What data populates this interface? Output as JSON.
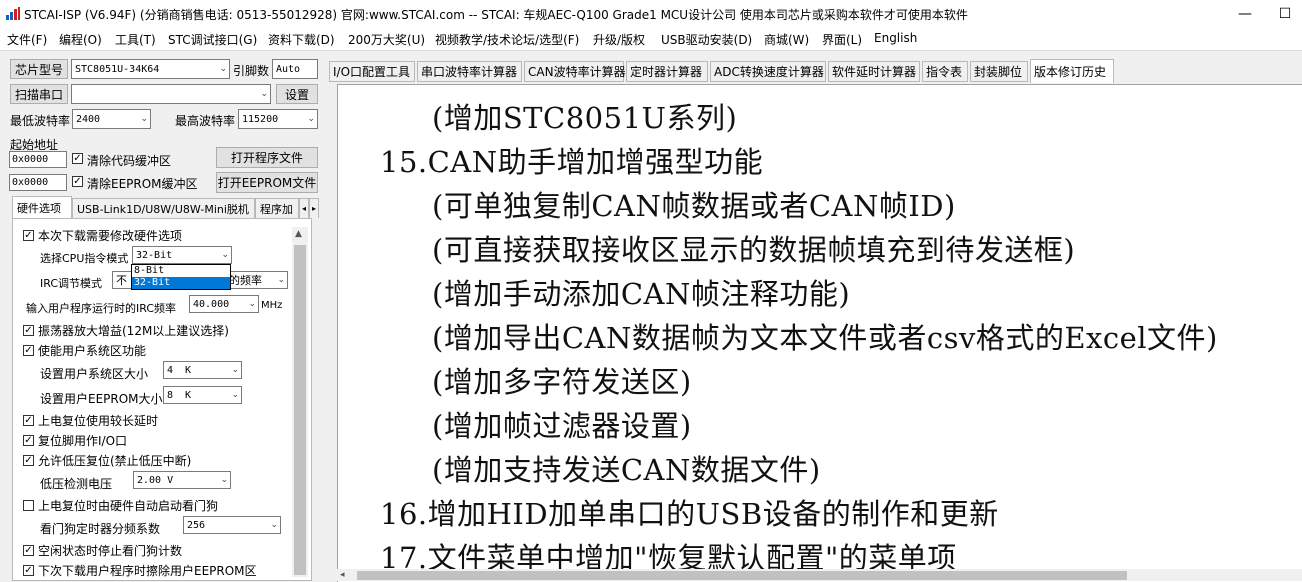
{
  "title": "STCAI-ISP (V6.94F) (分销商销售电话: 0513-55012928) 官网:www.STCAI.com  -- STCAI: 车规AEC-Q100 Grade1 MCU设计公司 使用本司芯片或采购本软件才可使用本软件",
  "window": {
    "minimize": "—",
    "maximize": "☐"
  },
  "menu": [
    "文件(F)",
    "编程(O)",
    "工具(T)",
    "STC调试接口(G)",
    "资料下载(D)",
    "200万大奖(U)",
    "视频教学/技术论坛/选型(F)",
    "升级/版权",
    "USB驱动安装(D)",
    "商城(W)",
    "界面(L)",
    "English"
  ],
  "left": {
    "chip_label": "芯片型号",
    "chip_value": "STC8051U-34K64",
    "pin_label": "引脚数",
    "pin_value": "Auto",
    "scan_label": "扫描串口",
    "port_value": "",
    "settings_label": "设置",
    "min_baud_label": "最低波特率",
    "min_baud_value": "2400",
    "max_baud_label": "最高波特率",
    "max_baud_value": "115200",
    "start_addr_label": "起始地址",
    "addr1": "0x0000",
    "clear_code": "清除代码缓冲区",
    "open_prog": "打开程序文件",
    "addr2": "0x0000",
    "clear_eeprom": "清除EEPROM缓冲区",
    "open_eeprom": "打开EEPROM文件"
  },
  "left_tabs": [
    "硬件选项",
    "USB-Link1D/U8W/U8W-Mini脱机",
    "程序加"
  ],
  "hw": {
    "need_modify": "本次下载需要修改硬件选项",
    "cpu_mode_label": "选择CPU指令模式",
    "cpu_mode_value": "32-Bit",
    "cpu_mode_options": [
      "8-Bit",
      "32-Bit"
    ],
    "irc_mode_label": "IRC调节模式",
    "irc_mode_value_left": "不",
    "irc_mode_value_right": "的频率",
    "irc_freq_label": "输入用户程序运行时的IRC频率",
    "irc_freq_value": "40.000",
    "irc_freq_unit": "MHz",
    "osc_gain": "振荡器放大增益(12M以上建议选择)",
    "user_sys": "使能用户系统区功能",
    "sys_size_label": "设置用户系统区大小",
    "sys_size_value": "4  K",
    "eeprom_size_label": "设置用户EEPROM大小",
    "eeprom_size_value": "8  K",
    "long_delay": "上电复位使用较长延时",
    "reset_io": "复位脚用作I/O口",
    "low_volt_reset": "允许低压复位(禁止低压中断)",
    "low_volt_label": "低压检测电压",
    "low_volt_value": "2.00 V",
    "watchdog": "上电复位时由硬件自动启动看门狗",
    "wdt_div_label": "看门狗定时器分频系数",
    "wdt_div_value": "256",
    "idle_wdt": "空闲状态时停止看门狗计数",
    "erase_eeprom": "下次下载用户程序时擦除用户EEPROM区"
  },
  "right_tabs": [
    "I/O口配置工具",
    "串口波特率计算器",
    "CAN波特率计算器",
    "定时器计算器",
    "ADC转换速度计算器",
    "软件延时计算器",
    "指令表",
    "封装脚位",
    "版本修订历史"
  ],
  "content_lines": [
    "(增加STC8051U系列)",
    "15.CAN助手增加增强型功能",
    "(可单独复制CAN帧数据或者CAN帧ID)",
    "(可直接获取接收区显示的数据帧填充到待发送框)",
    "(增加手动添加CAN帧注释功能)",
    "(增加导出CAN数据帧为文本文件或者csv格式的Excel文件)",
    "(增加多字符发送区)",
    "(增加帧过滤器设置)",
    "(增加支持发送CAN数据文件)",
    "16.增加HID加单串口的USB设备的制作和更新",
    "17.文件菜单中增加\"恢复默认配置\"的菜单项"
  ],
  "icons": {
    "check": "✓",
    "down": "⌄"
  }
}
